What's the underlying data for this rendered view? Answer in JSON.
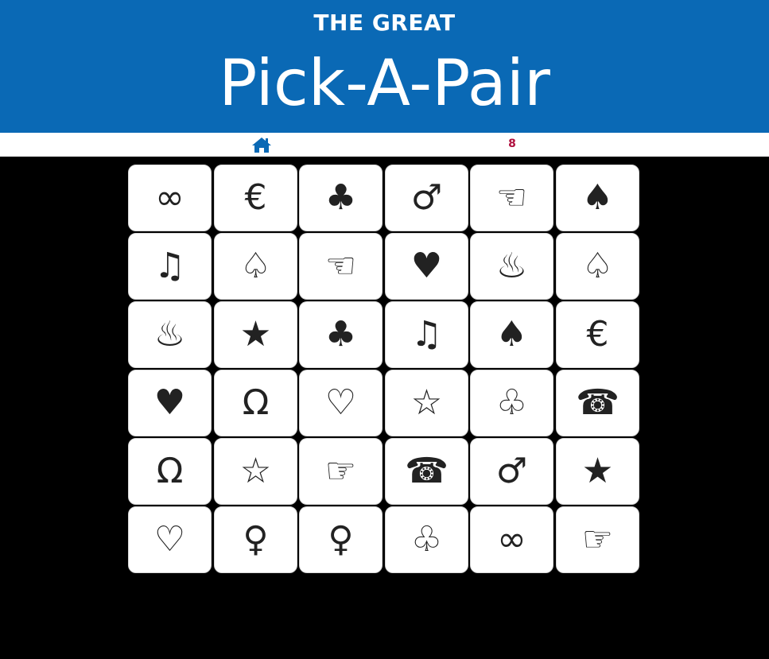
{
  "header": {
    "subtitle": "THE GREAT",
    "title": "Pick-A-Pair",
    "background_color": "#0a69b5"
  },
  "status": {
    "home_icon": "home-icon",
    "score": "8",
    "score_color": "#b0103e"
  },
  "board": {
    "rows": 6,
    "cols": 6,
    "cards": [
      {
        "symbol": "∞",
        "name": "infinity"
      },
      {
        "symbol": "€",
        "name": "euro"
      },
      {
        "symbol": "♣",
        "name": "club-filled"
      },
      {
        "symbol": "♂",
        "name": "male-sign"
      },
      {
        "symbol": "☜",
        "name": "pointing-hand-left"
      },
      {
        "symbol": "♠",
        "name": "spade-filled"
      },
      {
        "symbol": "♫",
        "name": "music-notes"
      },
      {
        "symbol": "♤",
        "name": "spade-outline"
      },
      {
        "symbol": "☜",
        "name": "pointing-hand-left"
      },
      {
        "symbol": "♥",
        "name": "heart-filled"
      },
      {
        "symbol": "♨",
        "name": "hot-springs"
      },
      {
        "symbol": "♤",
        "name": "spade-outline"
      },
      {
        "symbol": "♨",
        "name": "hot-springs"
      },
      {
        "symbol": "★",
        "name": "star-filled"
      },
      {
        "symbol": "♣",
        "name": "club-filled"
      },
      {
        "symbol": "♫",
        "name": "music-notes"
      },
      {
        "symbol": "♠",
        "name": "spade-filled"
      },
      {
        "symbol": "€",
        "name": "euro"
      },
      {
        "symbol": "♥",
        "name": "heart-filled"
      },
      {
        "symbol": "Ω",
        "name": "omega"
      },
      {
        "symbol": "♡",
        "name": "heart-outline"
      },
      {
        "symbol": "☆",
        "name": "star-outline"
      },
      {
        "symbol": "♧",
        "name": "club-outline"
      },
      {
        "symbol": "☎",
        "name": "telephone"
      },
      {
        "symbol": "Ω",
        "name": "omega"
      },
      {
        "symbol": "☆",
        "name": "star-outline"
      },
      {
        "symbol": "☞",
        "name": "pointing-hand-right"
      },
      {
        "symbol": "☎",
        "name": "telephone"
      },
      {
        "symbol": "♂",
        "name": "male-sign"
      },
      {
        "symbol": "★",
        "name": "star-filled"
      },
      {
        "symbol": "♡",
        "name": "heart-outline"
      },
      {
        "symbol": "♀",
        "name": "female-sign"
      },
      {
        "symbol": "♀",
        "name": "female-sign"
      },
      {
        "symbol": "♧",
        "name": "club-outline"
      },
      {
        "symbol": "∞",
        "name": "infinity"
      },
      {
        "symbol": "☞",
        "name": "pointing-hand-right"
      }
    ]
  }
}
